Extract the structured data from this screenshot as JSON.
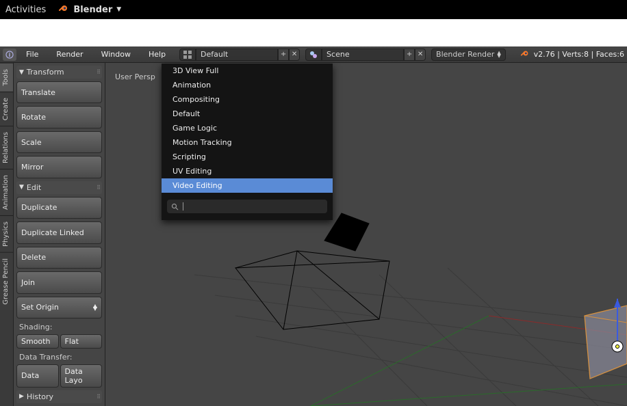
{
  "os_bar": {
    "activities": "Activities",
    "app_name": "Blender"
  },
  "header": {
    "menus": [
      "File",
      "Render",
      "Window",
      "Help"
    ],
    "layout_field": "Default",
    "scene_field": "Scene",
    "engine": "Blender Render",
    "stats": "v2.76 | Verts:8 | Faces:6"
  },
  "side_tabs": [
    "Tools",
    "Create",
    "Relations",
    "Animation",
    "Physics",
    "Grease Pencil"
  ],
  "panel": {
    "transform": {
      "title": "Transform",
      "buttons": [
        "Translate",
        "Rotate",
        "Scale"
      ],
      "mirror": "Mirror"
    },
    "edit": {
      "title": "Edit",
      "buttons": [
        "Duplicate",
        "Duplicate Linked",
        "Delete"
      ],
      "join": "Join",
      "origin": "Set Origin",
      "shading_label": "Shading:",
      "smooth": "Smooth",
      "flat": "Flat",
      "data_transfer_label": "Data Transfer:",
      "data": "Data",
      "data_layout": "Data Layo"
    },
    "history": {
      "title": "History"
    }
  },
  "viewport": {
    "label": "User Persp"
  },
  "dropdown": {
    "items": [
      {
        "label": "3D View Full",
        "highlighted": false
      },
      {
        "label": "Animation",
        "highlighted": false
      },
      {
        "label": "Compositing",
        "highlighted": false
      },
      {
        "label": "Default",
        "highlighted": false
      },
      {
        "label": "Game Logic",
        "highlighted": false
      },
      {
        "label": "Motion Tracking",
        "highlighted": false
      },
      {
        "label": "Scripting",
        "highlighted": false
      },
      {
        "label": "UV Editing",
        "highlighted": false
      },
      {
        "label": "Video Editing",
        "highlighted": true
      }
    ],
    "search_value": ""
  },
  "colors": {
    "accent": "#5a8bd6",
    "orange": "#f5792a",
    "bg": "#454545"
  }
}
